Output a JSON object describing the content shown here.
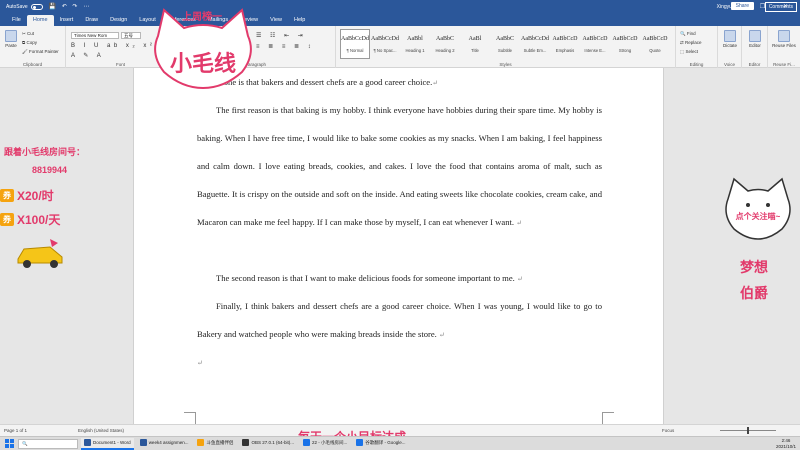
{
  "titlebar": {
    "autosave": "AutoSave",
    "quick_access": "💾 ↶ ↷ ⋯",
    "doc_title": "",
    "user": "Xingyu Liu",
    "window_buttons": "– ❐ ✕"
  },
  "tabs": [
    "File",
    "Home",
    "Insert",
    "Draw",
    "Design",
    "Layout",
    "References",
    "Mailings",
    "Review",
    "View",
    "Help"
  ],
  "share_label": "Share",
  "comments_label": "Comments",
  "ribbon": {
    "clipboard": {
      "paste": "Paste",
      "cut": "Cut",
      "copy": "Copy",
      "format_painter": "Format Painter",
      "label": "Clipboard"
    },
    "font": {
      "name": "Times New Rom",
      "size": "五号",
      "label": "Font"
    },
    "paragraph_label": "Paragraph",
    "styles": [
      {
        "sample": "AaBbCcDd",
        "name": "¶ Normal",
        "selected": true
      },
      {
        "sample": "AaBbCcDd",
        "name": "¶ No Spac...",
        "selected": false
      },
      {
        "sample": "AaBbl",
        "name": "Heading 1",
        "selected": false
      },
      {
        "sample": "AaBbC",
        "name": "Heading 2",
        "selected": false
      },
      {
        "sample": "AaBl",
        "name": "Title",
        "selected": false
      },
      {
        "sample": "AaBbC",
        "name": "Subtitle",
        "selected": false
      },
      {
        "sample": "AaBbCcDd",
        "name": "Subtle Em...",
        "selected": false
      },
      {
        "sample": "AaBbCcD",
        "name": "Emphasis",
        "selected": false
      },
      {
        "sample": "AaBbCcD",
        "name": "Intense E...",
        "selected": false
      },
      {
        "sample": "AaBbCcD",
        "name": "Strong",
        "selected": false
      },
      {
        "sample": "AaBbCcD",
        "name": "Quote",
        "selected": false
      }
    ],
    "styles_label": "Styles",
    "editing": {
      "find": "Find",
      "replace": "Replace",
      "select": "Select",
      "label": "Editing"
    },
    "voice": {
      "dictate": "Dictate",
      "label": "Voice"
    },
    "editor": {
      "editor": "Editor",
      "label": "Editor"
    },
    "reuse": {
      "reuse": "Reuse Files",
      "label": "Reuse Fi..."
    }
  },
  "document": {
    "p1": "the last one is that bakers and dessert chefs are a good career choice.",
    "p2": "The first reason is that baking is my hobby. I think everyone have hobbies during their spare time. My hobby is baking. When I have free time, I would like to bake some cookies as my snacks. When I am baking, I feel happiness and calm down. I love eating breads, cookies, and cakes. I love the food that contains aroma of malt, such as Baguette. It is crispy on the outside and soft on the inside. And eating sweets like chocolate cookies, cream cake, and Macaron can make me feel happy. If I can make those by myself, I can eat whenever I want.",
    "p3": "The second reason is that I want to make delicious foods for someone important to me.",
    "p4": "Finally, I think bakers and dessert chefs are a good career choice. When I was young, I would like to go to Bakery and watched people who were making breads inside the store.",
    "para_mark": "↵"
  },
  "overlays": {
    "cat_top": "上周榜一",
    "cat_name": "小毛线",
    "promo_title": "跟着小毛线房间号：",
    "promo_room": "8819944",
    "coupon": "券",
    "price1": "X20/时",
    "price2": "X100/天",
    "right_bubble": "点个关注喵~",
    "right_line1": "梦想",
    "right_line2": "伯爵",
    "bottom_banner": "每天一个小目标达成"
  },
  "statusbar": {
    "page": "Page 1 of 1",
    "words": "",
    "language": "English (United States)",
    "focus": "Focus",
    "zoom_fraction": 0.5
  },
  "taskbar": {
    "search": "",
    "apps": [
      {
        "label": "Document1 - Word",
        "color": "#2b579a",
        "active": true
      },
      {
        "label": "week4 assignmen...",
        "color": "#2b579a",
        "active": false
      },
      {
        "label": "斗鱼直播伴侣",
        "color": "#f5a30f",
        "active": false
      },
      {
        "label": "OBS 27.0.1 (64-bit)...",
        "color": "#333333",
        "active": false
      },
      {
        "label": "22 - 小毛线房间...",
        "color": "#1a73e8",
        "active": false
      },
      {
        "label": "谷歌翻译 - Google...",
        "color": "#1a73e8",
        "active": false
      }
    ],
    "time": "2:46",
    "date": "2021/10/1"
  },
  "colors": {
    "word_blue": "#2b579a",
    "overlay_pink": "#e23a6b",
    "coupon_orange": "#f5a30f"
  }
}
